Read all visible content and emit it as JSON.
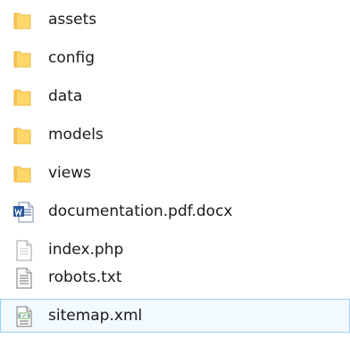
{
  "files": {
    "items": [
      {
        "name": "assets",
        "type": "folder"
      },
      {
        "name": "config",
        "type": "folder"
      },
      {
        "name": "data",
        "type": "folder"
      },
      {
        "name": "models",
        "type": "folder"
      },
      {
        "name": "views",
        "type": "folder"
      },
      {
        "name": "documentation.pdf.docx",
        "type": "word"
      },
      {
        "name": "index.php",
        "type": "php"
      },
      {
        "name": "robots.txt",
        "type": "text"
      },
      {
        "name": "sitemap.xml",
        "type": "xml",
        "selected": true
      }
    ]
  },
  "icons": {
    "folder": "folder-icon",
    "word": "word-document-icon",
    "php": "php-file-icon",
    "text": "text-file-icon",
    "xml": "xml-file-icon"
  },
  "colors": {
    "folder_fill": "#ffd86c",
    "folder_edge": "#e9b741",
    "word_blue": "#2b579a",
    "selection_border": "#99d1ff",
    "selection_fill": "#f2f9ff",
    "text": "#1a1a1a"
  }
}
